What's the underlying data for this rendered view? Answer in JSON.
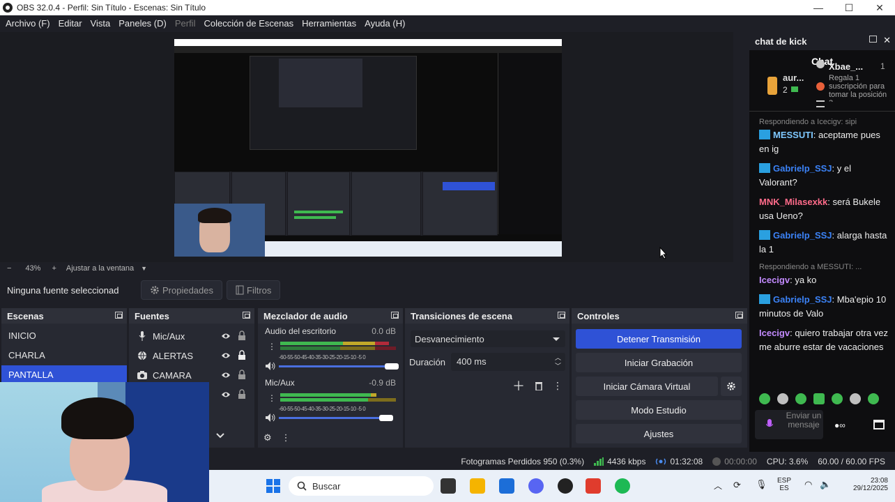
{
  "window": {
    "title": "OBS 32.0.4 - Perfil: Sin Título - Escenas: Sin Título",
    "minimize": "—",
    "maximize": "☐",
    "close": "✕"
  },
  "menu": [
    {
      "label": "Archivo (F)",
      "enabled": true
    },
    {
      "label": "Editar",
      "enabled": true
    },
    {
      "label": "Vista",
      "enabled": true
    },
    {
      "label": "Paneles (D)",
      "enabled": true
    },
    {
      "label": "Perfil",
      "enabled": false
    },
    {
      "label": "Colección de Escenas",
      "enabled": true
    },
    {
      "label": "Herramientas",
      "enabled": true
    },
    {
      "label": "Ayuda (H)",
      "enabled": true
    }
  ],
  "zoom": {
    "minus": "−",
    "value": "43%",
    "plus": "+",
    "fit_label": "Ajustar a la ventana"
  },
  "source_toolbar": {
    "no_source": "Ninguna fuente seleccionad",
    "properties": "Propiedades",
    "filters": "Filtros"
  },
  "scenes": {
    "title": "Escenas",
    "items": [
      {
        "label": "INICIO",
        "active": false
      },
      {
        "label": "CHARLA",
        "active": false
      },
      {
        "label": "PANTALLA",
        "active": true
      }
    ]
  },
  "sources": {
    "title": "Fuentes",
    "items": [
      {
        "label": "Mic/Aux",
        "icon": "microphone-icon"
      },
      {
        "label": "ALERTAS",
        "icon": "browser-icon"
      },
      {
        "label": "CAMARA",
        "icon": "camera-icon"
      }
    ]
  },
  "mixer": {
    "title": "Mezclador de audio",
    "channels": [
      {
        "name": "Audio del escritorio",
        "db": "0.0 dB"
      },
      {
        "name": "Mic/Aux",
        "db": "-0.9 dB"
      }
    ],
    "scale": "-60-55-50-45-40-35-30-25-20-15-10 -5  0"
  },
  "transitions": {
    "title": "Transiciones de escena",
    "selected": "Desvanecimiento",
    "duration_label": "Duración",
    "duration_value": "400 ms"
  },
  "controls": {
    "title": "Controles",
    "stop_stream": "Detener Transmisión",
    "start_recording": "Iniciar Grabación",
    "virtual_cam": "Iniciar Cámara Virtual",
    "studio_mode": "Modo Estudio",
    "settings": "Ajustes"
  },
  "status": {
    "dropped": "Fotogramas Perdidos 950 (0.3%)",
    "bitrate": "4436 kbps",
    "stream_time": "01:32:08",
    "rec_time": "00:00:00",
    "cpu": "CPU: 3.6%",
    "fps": "60.00 / 60.00 FPS"
  },
  "taskbar": {
    "search": "Buscar",
    "lang_top": "ESP",
    "lang_bottom": "ES",
    "time": "23:08",
    "date": "29/12/2025"
  },
  "chat": {
    "dock_title": "chat de kick",
    "title": "Chat",
    "pinned_user": "aur...",
    "pinned_count": "2",
    "gift_user": "Xbae_...",
    "gift_rank": "1",
    "gift_text": "Regala 1 suscripción para tomar la posición 3",
    "messages": [
      {
        "reply": "Respondiendo a Icecigv: sipi",
        "user": "MESSUTI",
        "color": "#7ec8ff",
        "badge": true,
        "text": ": aceptame pues en ig"
      },
      {
        "reply": "",
        "user": "Gabrielp_SSJ",
        "color": "#3b82f6",
        "badge": true,
        "text": ": y el Valorant?"
      },
      {
        "reply": "",
        "user": "MNK_Milasexkk",
        "color": "#ff6b8a",
        "badge": false,
        "text": ": será Bukele usa Ueno?"
      },
      {
        "reply": "",
        "user": "Gabrielp_SSJ",
        "color": "#3b82f6",
        "badge": true,
        "text": ": alarga hasta la 1"
      },
      {
        "reply": "Respondiendo a MESSUTI: ...",
        "user": "Icecigv",
        "color": "#c38bff",
        "badge": false,
        "text": ": ya ko"
      },
      {
        "reply": "",
        "user": "Gabrielp_SSJ",
        "color": "#3b82f6",
        "badge": true,
        "text": ": Mba'epio 10 minutos de Valo"
      },
      {
        "reply": "",
        "user": "Icecigv",
        "color": "#c38bff",
        "badge": false,
        "text": ": quiero trabajar otra vez me aburre estar de vacaciones"
      }
    ],
    "input_placeholder": "Enviar un mensaje"
  }
}
